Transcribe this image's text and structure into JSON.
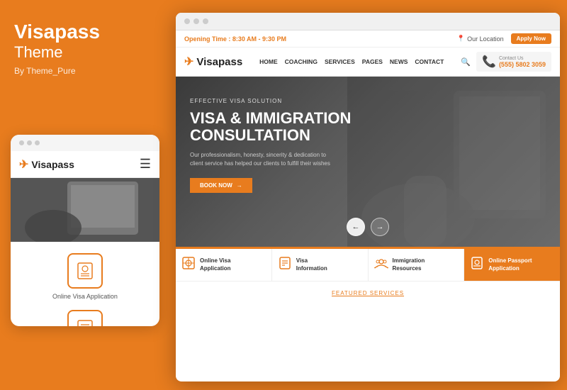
{
  "brand": {
    "title": "Visapass",
    "subtitle": "Theme",
    "by": "By Theme_Pure"
  },
  "browser": {
    "opening_time_label": "Opening Time :",
    "opening_time_value": "8:30 AM - 9:30 PM",
    "location": "Our Location",
    "apply_now": "Apply Now",
    "contact_label": "Contact Us",
    "contact_phone": "(555) 5802 3059",
    "logo": "Visapass",
    "nav": {
      "home": "HOME",
      "coaching": "COACHING",
      "services": "SERVICES",
      "pages": "PAGES",
      "news": "NEWS",
      "contact": "CONTACT"
    },
    "hero": {
      "eyebrow": "EFFECTIVE VISA SOLUTION",
      "title": "VISA & IMMIGRATION CONSULTATION",
      "description": "Our professionalism, honesty, sincerity & dedication to client service has helped our clients to fulfill their wishes",
      "cta": "BOOK NOW"
    },
    "services": [
      {
        "icon": "🌐",
        "name": "Online Visa Application"
      },
      {
        "icon": "📋",
        "name": "Visa Information"
      },
      {
        "icon": "🤝",
        "name": "Immigration Resources"
      },
      {
        "icon": "📄",
        "name": "Online Passport Application"
      }
    ],
    "featured": "FEATURED SERVICES"
  },
  "mobile": {
    "logo": "Visapass",
    "icon1_label": "Online Visa Application",
    "icon2_label": ""
  }
}
